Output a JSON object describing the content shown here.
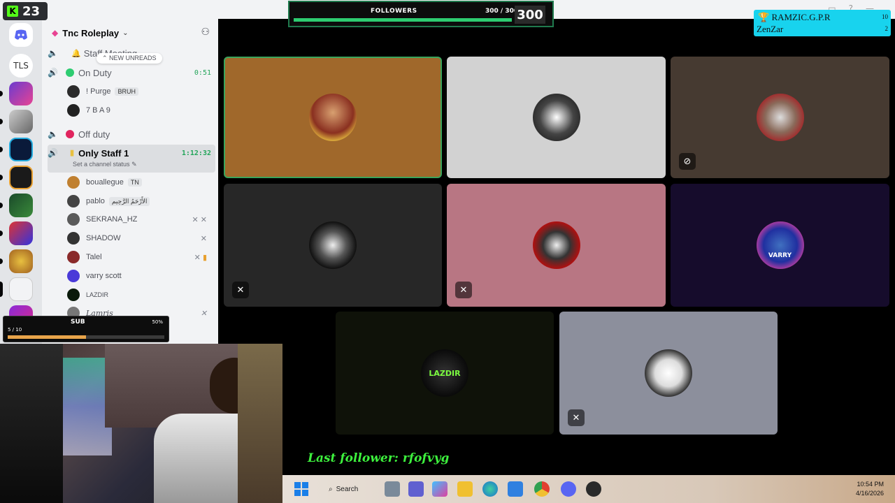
{
  "kick": {
    "count": "23"
  },
  "followers": {
    "label": "FOLLOWERS",
    "count": "300 / 300",
    "big": "300",
    "progress": 1.0
  },
  "ramzic": {
    "line1": "RAMZIC.G.P.R",
    "line2": "ZenZar",
    "num1": "10",
    "num2": "2"
  },
  "server": {
    "name": "Tnc Roleplay"
  },
  "rail": {
    "tls": "TLS"
  },
  "new_unreads": "NEW UNREADS",
  "channels": {
    "staff_meeting": "Staff Meeting",
    "on_duty": {
      "label": "On Duty",
      "timer": "0:51"
    },
    "off_duty": "Off duty",
    "only_staff": {
      "label": "Only Staff 1",
      "timer": "1:12:32",
      "status": "Set a channel status"
    }
  },
  "on_duty_members": [
    {
      "name": "! Purge",
      "tag": "BRUH"
    },
    {
      "name": "7 B A 9"
    }
  ],
  "staff_members": [
    {
      "name": "bouallegue",
      "tag": "TN"
    },
    {
      "name": "pablo",
      "tag": "الأَرْحَمُ الرَّحِيم"
    },
    {
      "name": "SEKRANA_HZ"
    },
    {
      "name": "SHADOW"
    },
    {
      "name": "Talel"
    },
    {
      "name": "varry scott"
    },
    {
      "name": "LAZDIR"
    },
    {
      "name": "Lamris"
    }
  ],
  "tile_text": {
    "varry": "VARRY",
    "lazdir": "LAZDIR"
  },
  "sub": {
    "label": "SUB",
    "count": "5 / 10",
    "pct": "50%",
    "progress": 0.5
  },
  "last_follower": "Last follower: rfofvyg",
  "taskbar": {
    "search": "Search",
    "time": "10:54 PM",
    "date": "4/16/2026"
  },
  "colors": {
    "kick": "#53fc18",
    "followers_bar": "#2ecc71",
    "ramzic_bg": "#18d3ee",
    "last_follower": "#3df03d"
  }
}
